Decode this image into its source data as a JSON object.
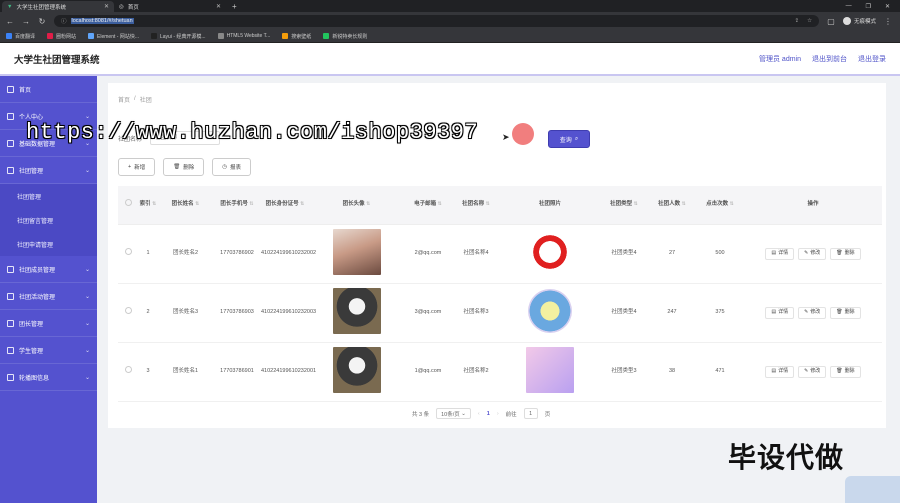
{
  "browser": {
    "tabs": [
      {
        "title": "大学生社团管理系统",
        "active": true
      },
      {
        "title": "首页",
        "active": false
      }
    ],
    "url": "localhost:8081/#/shetuan",
    "profile_label": "无痕模式",
    "bookmarks": [
      {
        "label": "百度翻译",
        "color": "#3b82f6"
      },
      {
        "label": "圈粉网站",
        "color": "#e11d48"
      },
      {
        "label": "Element - 网站快...",
        "color": "#60a5fa"
      },
      {
        "label": "Layui - 经典开源模...",
        "color": "#222"
      },
      {
        "label": "HTML5 Website T...",
        "color": "#888"
      },
      {
        "label": "搜索壁纸",
        "color": "#f59e0b"
      },
      {
        "label": "新锐特卖长规则",
        "color": "#22c55e"
      }
    ]
  },
  "header": {
    "title": "大学生社团管理系统",
    "admin": "管理员 admin",
    "back_front": "退出到前台",
    "logout": "退出登录"
  },
  "sidebar": {
    "items": [
      {
        "label": "首页",
        "chevron": false
      },
      {
        "label": "个人中心",
        "chevron": true
      },
      {
        "label": "基础数据管理",
        "chevron": true
      },
      {
        "label": "社团管理",
        "chevron": true,
        "open": true
      }
    ],
    "subitems": [
      "社团管理",
      "社团留言管理",
      "社团申请管理"
    ],
    "items_after": [
      {
        "label": "社团成员管理"
      },
      {
        "label": "社团活动管理"
      },
      {
        "label": "团长管理"
      },
      {
        "label": "学生管理"
      },
      {
        "label": "轮播图信息"
      }
    ]
  },
  "breadcrumb": {
    "home": "首页",
    "sep": "/",
    "current": "社团"
  },
  "search": {
    "label": "社团名称",
    "placeholder": "社团名称",
    "query_button": "查询"
  },
  "actions": {
    "add": "新增",
    "delete": "删除",
    "report": "报表"
  },
  "table": {
    "headers": [
      "索引",
      "团长姓名",
      "团长手机号",
      "团长身份证号",
      "团长头像",
      "电子邮箱",
      "社团名称",
      "社团照片",
      "社团类型",
      "社团人数",
      "点击次数",
      "操作"
    ],
    "rows": [
      {
        "index": "1",
        "name": "团长姓名2",
        "phone": "17703786902",
        "idcard": "410224199610232002",
        "avatar": "girl",
        "email": "2@qq.com",
        "club": "社团名称4",
        "photo": "no",
        "type": "社团类型4",
        "members": "27",
        "clicks": "500"
      },
      {
        "index": "2",
        "name": "团长姓名3",
        "phone": "17703786903",
        "idcard": "410224199610232003",
        "avatar": "cat",
        "email": "3@qq.com",
        "club": "社团名称3",
        "photo": "badge",
        "type": "社团类型4",
        "members": "247",
        "clicks": "375"
      },
      {
        "index": "3",
        "name": "团长姓名1",
        "phone": "17703786901",
        "idcard": "410224199610232001",
        "avatar": "cat",
        "email": "1@qq.com",
        "club": "社团名称2",
        "photo": "jia",
        "type": "社团类型3",
        "members": "38",
        "clicks": "471"
      }
    ],
    "ops": {
      "detail": "详情",
      "edit": "修改",
      "delete": "删除"
    }
  },
  "pager": {
    "total": "共 3 条",
    "size": "10条/页",
    "page": "1",
    "goto": "前往",
    "goto_value": "1",
    "unit": "页"
  },
  "overlay": {
    "watermark": "https://www.huzhan.com/ishop39397",
    "stamp": "毕设代做"
  }
}
